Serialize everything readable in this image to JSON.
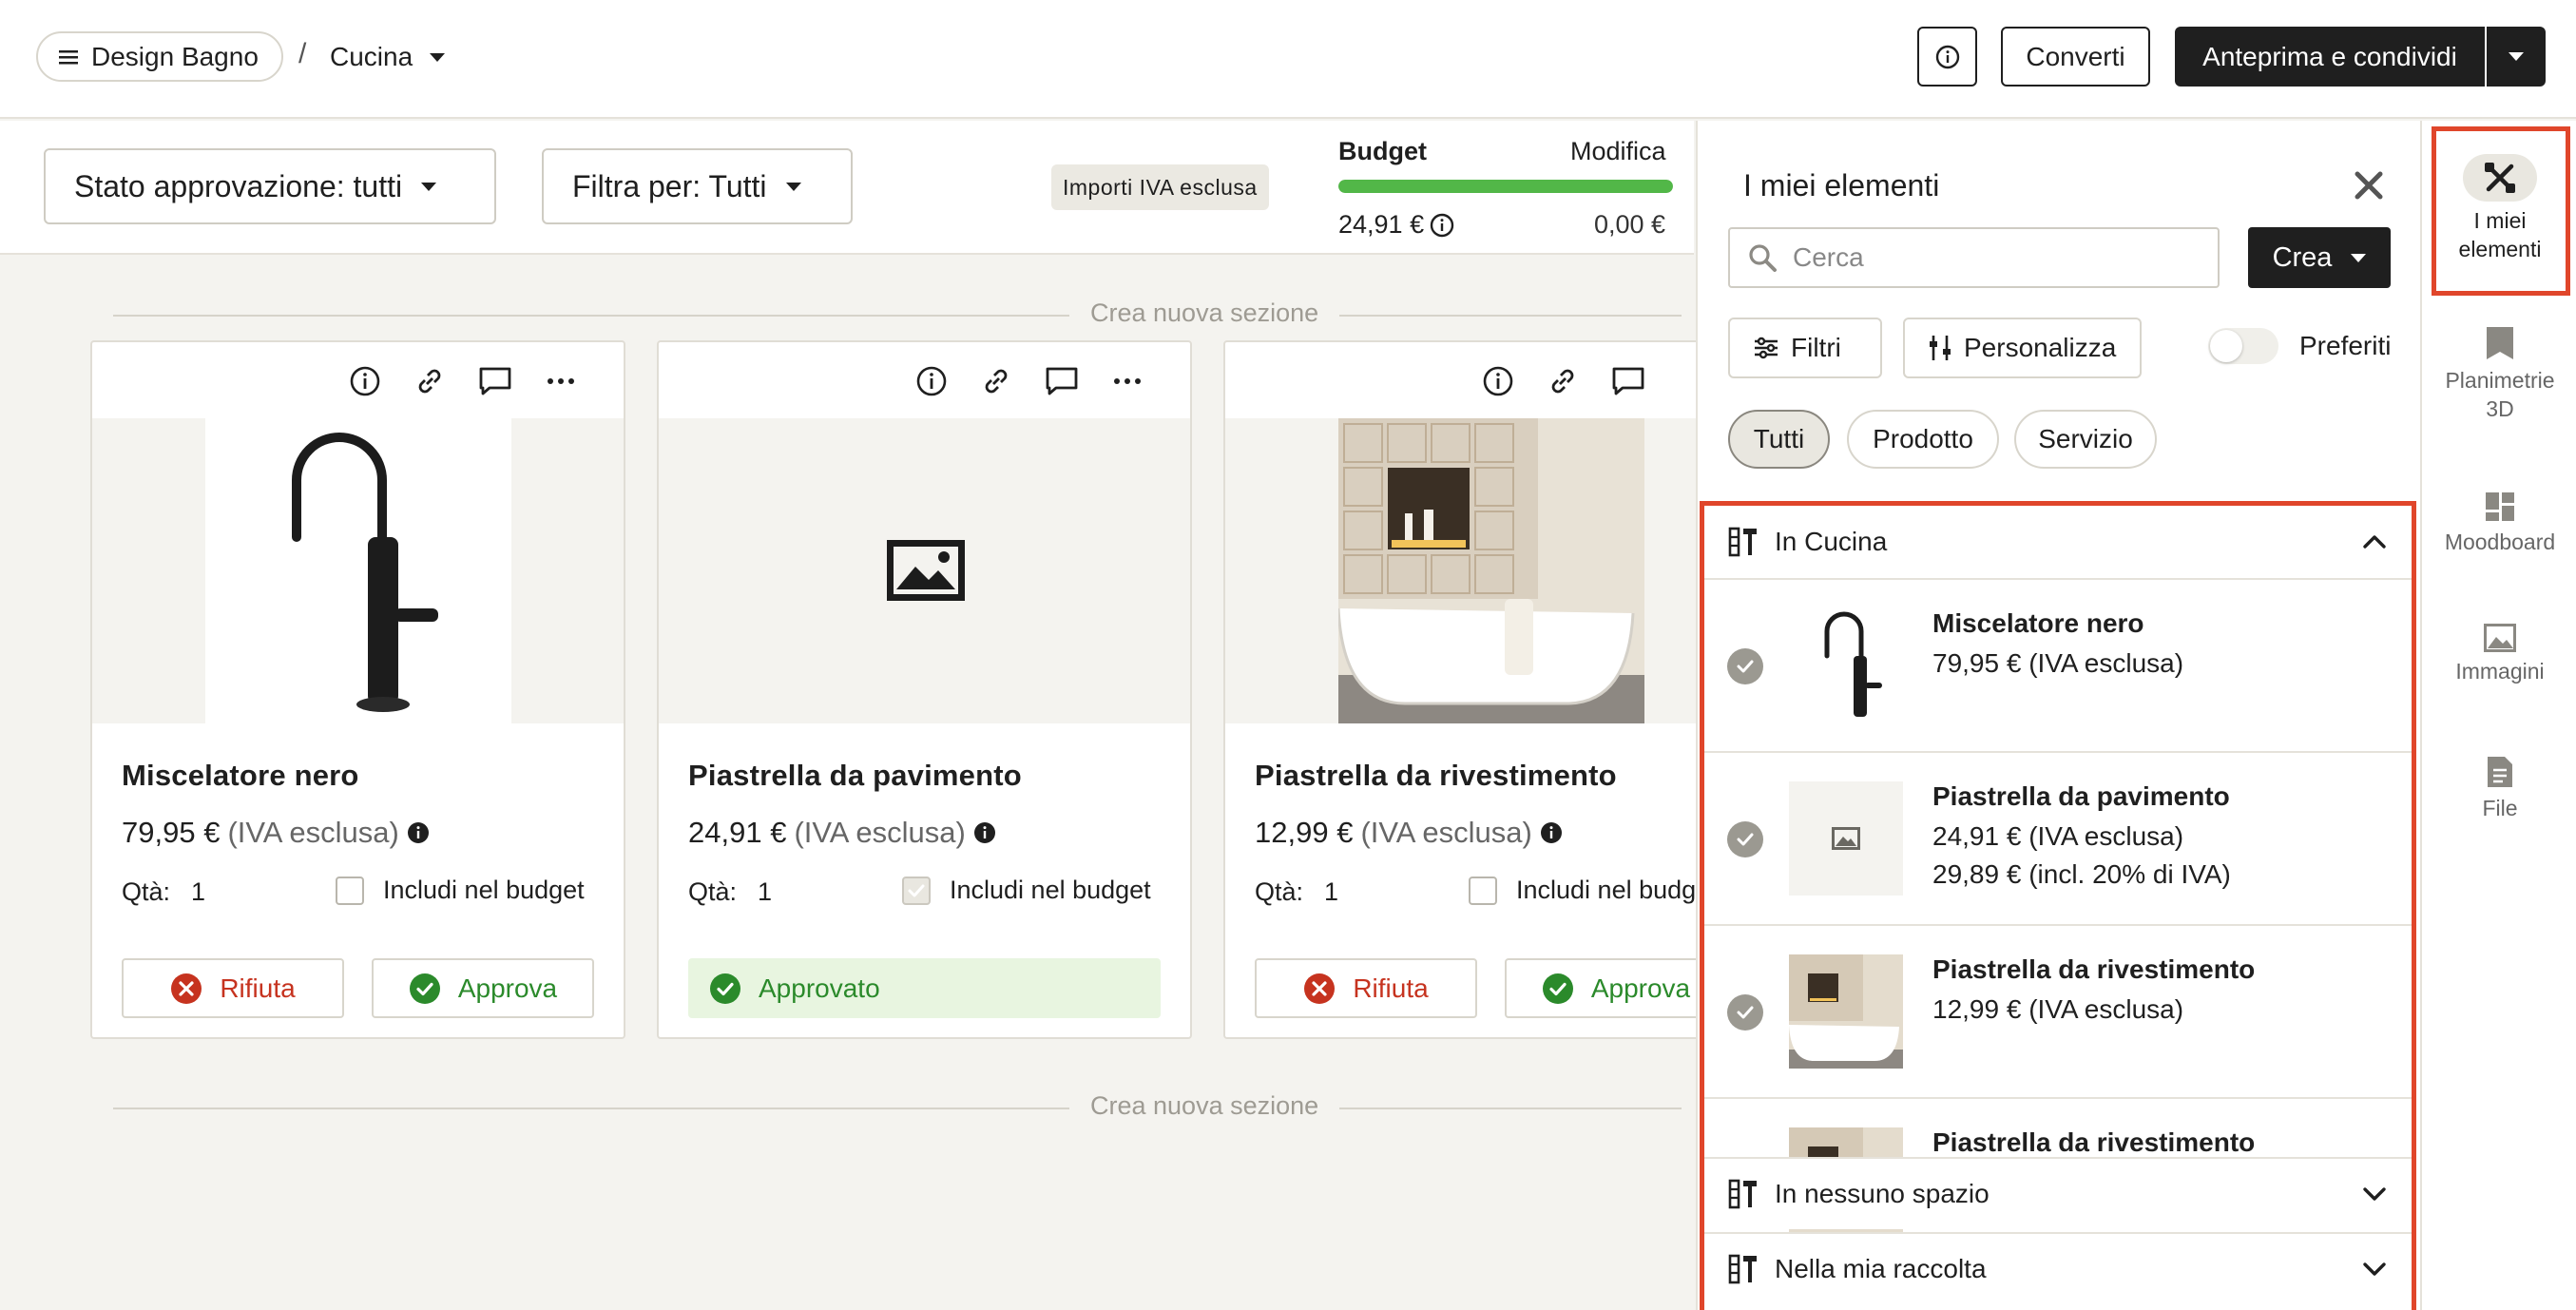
{
  "topbar": {
    "project_label": "Design Bagno",
    "separator": "/",
    "room_label": "Cucina",
    "convert_label": "Converti",
    "preview_label": "Anteprima e condividi"
  },
  "filters": {
    "approval_label": "Stato approvazione: tutti",
    "filter_label": "Filtra per: Tutti",
    "vat_badge": "Importi IVA esclusa"
  },
  "budget": {
    "label": "Budget",
    "edit_label": "Modifica",
    "spent": "24,91 €",
    "remaining": "0,00 €",
    "progress_fraction": 1.0,
    "bar_color": "#52b748"
  },
  "sections": {
    "new_section_label": "Crea nuova sezione"
  },
  "cards": [
    {
      "title": "Miscelatore nero",
      "price": "79,95 €",
      "vat_note": "(IVA esclusa)",
      "qty_label": "Qtà:",
      "qty": "1",
      "budget_label": "Includi nel budget",
      "budget_checked": false,
      "reject_label": "Rifiuta",
      "approve_label": "Approva",
      "image": "black-faucet"
    },
    {
      "title": "Piastrella da pavimento",
      "price": "24,91 €",
      "vat_note": "(IVA esclusa)",
      "qty_label": "Qtà:",
      "qty": "1",
      "budget_label": "Includi nel budget",
      "budget_checked": true,
      "approved_label": "Approvato",
      "image": "placeholder-image-icon"
    },
    {
      "title": "Piastrella da rivestimento",
      "price": "12,99 €",
      "vat_note": "(IVA esclusa)",
      "qty_label": "Qtà:",
      "qty": "1",
      "budget_label": "Includi nel budget",
      "budget_checked": false,
      "reject_label": "Rifiuta",
      "approve_label": "Approva",
      "image": "bathroom-tiles-bathtub"
    }
  ],
  "panel": {
    "title": "I miei elementi",
    "search_placeholder": "Cerca",
    "create_label": "Crea",
    "filters_label": "Filtri",
    "customize_label": "Personalizza",
    "favorites_label": "Preferiti",
    "chips": [
      "Tutti",
      "Prodotto",
      "Servizio"
    ],
    "active_chip": "Tutti",
    "groups": [
      {
        "label": "In Cucina",
        "expanded": true
      },
      {
        "label": "In nessuno spazio",
        "expanded": false
      },
      {
        "label": "Nella mia raccolta",
        "expanded": false
      }
    ],
    "items": [
      {
        "name": "Miscelatore nero",
        "price_line1": "79,95 € (IVA esclusa)",
        "price_line2": ""
      },
      {
        "name": "Piastrella da pavimento",
        "price_line1": "24,91 € (IVA esclusa)",
        "price_line2": "29,89 € (incl. 20% di IVA)"
      },
      {
        "name": "Piastrella da rivestimento",
        "price_line1": "12,99 € (IVA esclusa)",
        "price_line2": ""
      },
      {
        "name": "Piastrella da rivestimento",
        "price_line1": "",
        "price_line2": ""
      }
    ]
  },
  "rail": {
    "items": [
      {
        "label": "I miei elementi",
        "icon": "tools-icon",
        "active": true
      },
      {
        "label": "Planimetrie 3D",
        "icon": "floorplan-icon",
        "active": false
      },
      {
        "label": "Moodboard",
        "icon": "moodboard-icon",
        "active": false
      },
      {
        "label": "Immagini",
        "icon": "image-icon",
        "active": false
      },
      {
        "label": "File",
        "icon": "file-icon",
        "active": false
      }
    ]
  },
  "colors": {
    "accent_dark": "#1f1f1f",
    "highlight": "#e0462b",
    "approve_green": "#2b8a2b",
    "reject_red": "#c6331f"
  }
}
